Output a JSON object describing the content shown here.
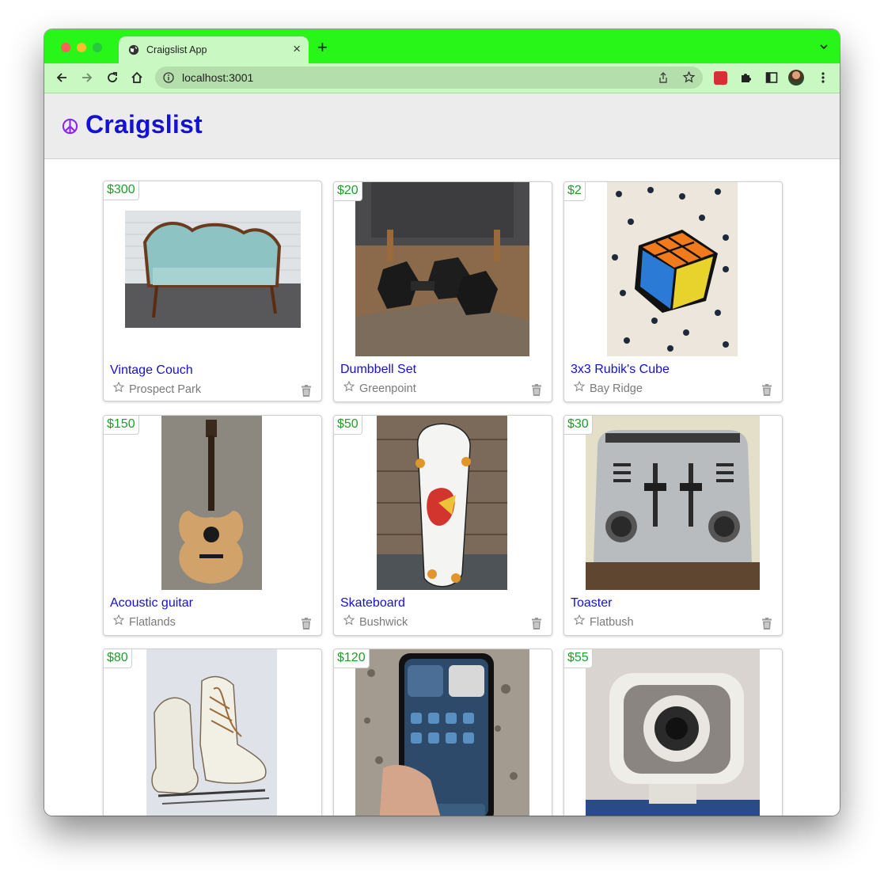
{
  "browser": {
    "tab_title": "Craigslist App",
    "tab_close": "×",
    "new_tab": "+",
    "url": "localhost:3001"
  },
  "colors": {
    "tabstrip": "#28f518",
    "toolbar": "#c9f8c2",
    "brand_title": "#1410d6",
    "price": "#1e9f2a",
    "peace_icon": "#8a2be2"
  },
  "site": {
    "logo_icon": "peace-icon",
    "title": "Craigslist"
  },
  "listings": [
    {
      "price": "$300",
      "title": "Vintage Couch",
      "location": "Prospect Park"
    },
    {
      "price": "$20",
      "title": "Dumbbell Set",
      "location": "Greenpoint"
    },
    {
      "price": "$2",
      "title": "3x3 Rubik's Cube",
      "location": "Bay Ridge"
    },
    {
      "price": "$150",
      "title": "Acoustic guitar",
      "location": "Flatlands"
    },
    {
      "price": "$50",
      "title": "Skateboard",
      "location": "Bushwick"
    },
    {
      "price": "$30",
      "title": "Toaster",
      "location": "Flatbush"
    },
    {
      "price": "$80",
      "title": "",
      "location": ""
    },
    {
      "price": "$120",
      "title": "",
      "location": ""
    },
    {
      "price": "$55",
      "title": "",
      "location": ""
    }
  ]
}
